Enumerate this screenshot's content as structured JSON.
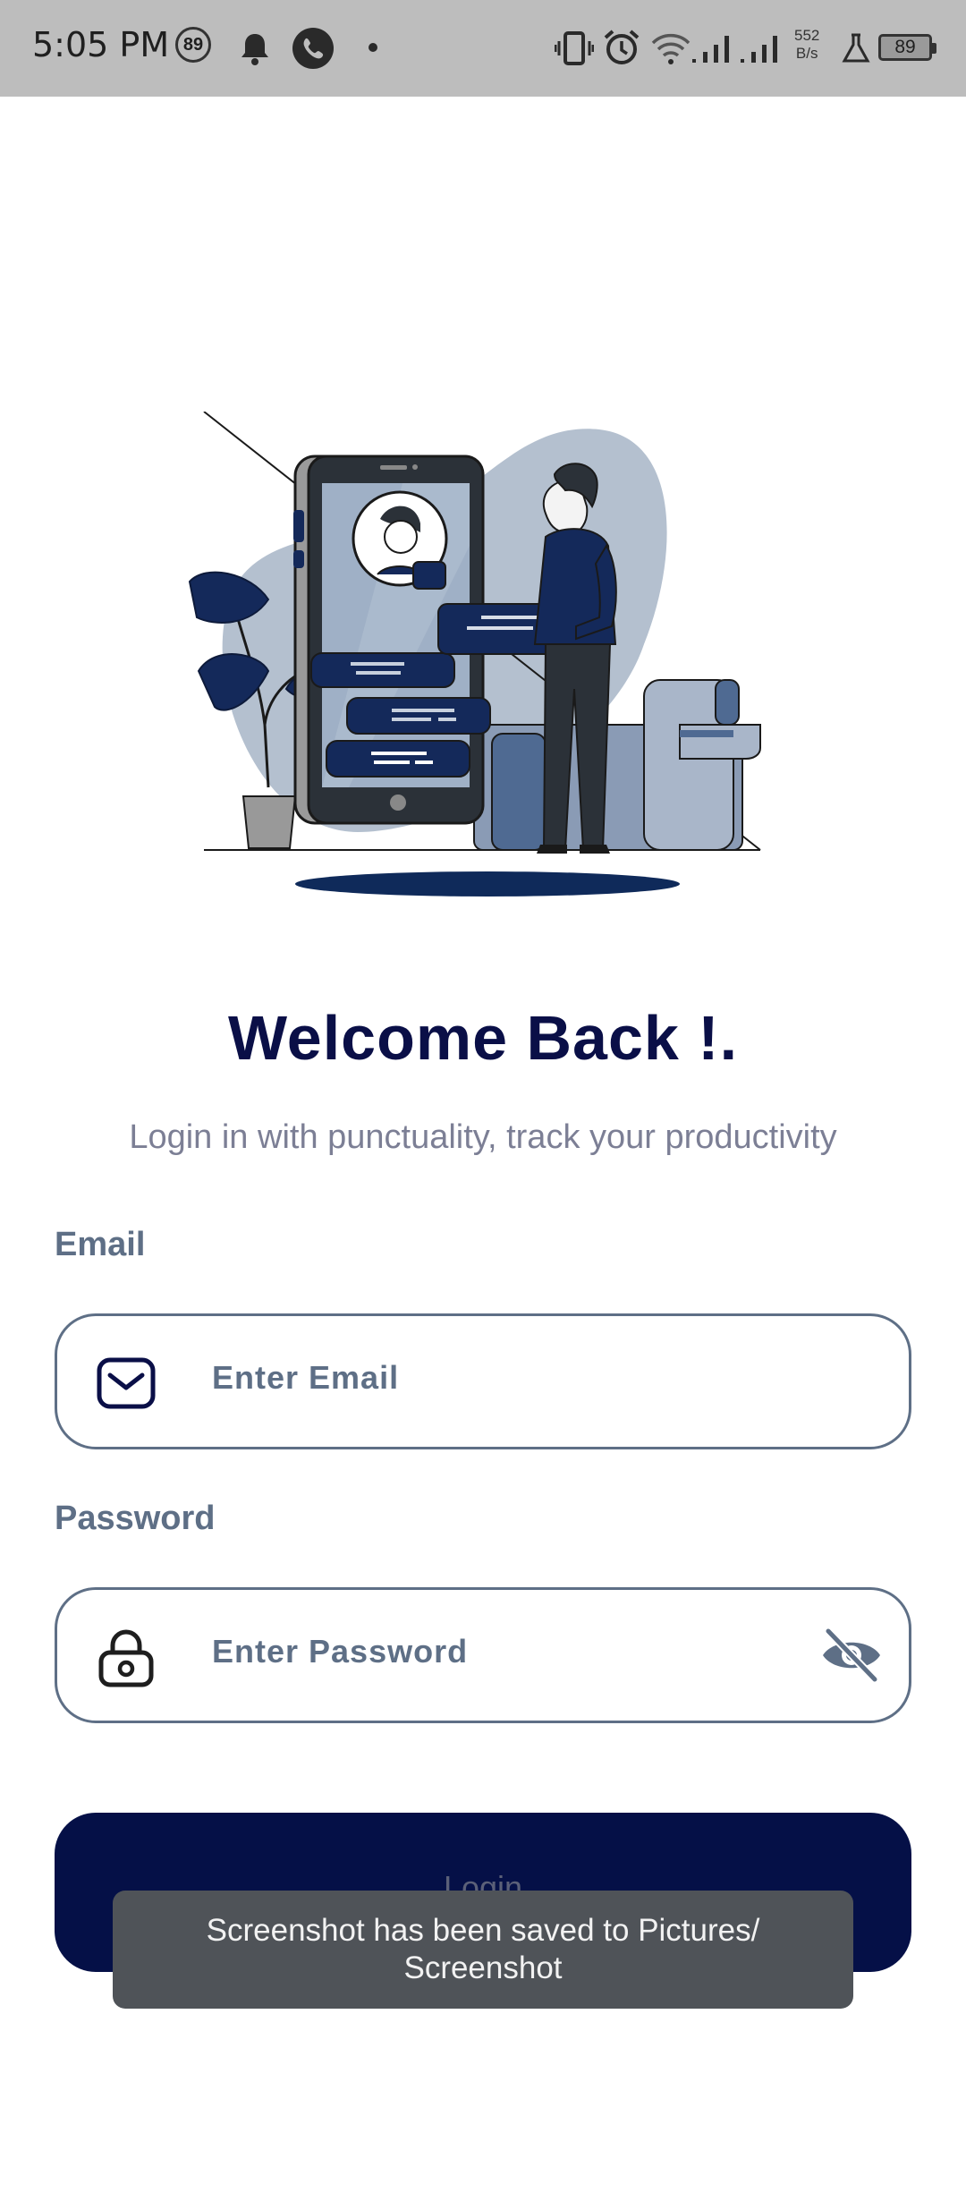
{
  "status_bar": {
    "time": "5:05 PM",
    "notification_badge": "89",
    "net_speed_value": "552",
    "net_speed_unit": "B/s",
    "battery": "89",
    "icons": [
      "notification-badge-icon",
      "bell-icon",
      "phone-call-icon",
      "dot-icon",
      "vibrate-icon",
      "alarm-icon",
      "wifi-icon",
      "signal-icon",
      "signal-icon",
      "flask-icon",
      "battery-icon"
    ]
  },
  "main": {
    "title": "Welcome Back !.",
    "subtitle": "Login in with punctuality, track your productivity"
  },
  "form": {
    "email_label": "Email",
    "email_placeholder": "Enter Email",
    "password_label": "Password",
    "password_placeholder": "Enter Password",
    "login_label": "Login"
  },
  "toast": {
    "message": "Screenshot has been saved to  Pictures/ Screenshot"
  },
  "colors": {
    "primary": "#051047",
    "title": "#0a0f47",
    "field_border": "#5e6f86",
    "illustration_navy": "#14295a",
    "illustration_blob": "#b4c0cf",
    "status_bar": "#bdbdbd"
  }
}
